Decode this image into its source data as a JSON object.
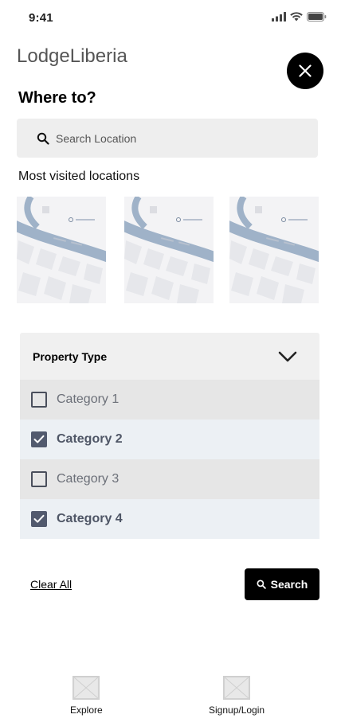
{
  "status_bar": {
    "time": "9:41",
    "icons": [
      "signal-icon",
      "wifi-icon",
      "battery-icon"
    ]
  },
  "header": {
    "app_title": "LodgeLiberia",
    "close_icon": "close-icon"
  },
  "search": {
    "heading": "Where to?",
    "placeholder": "Search Location",
    "icon": "search-icon"
  },
  "visited": {
    "heading": "Most visited locations",
    "thumbnail_count": 3
  },
  "property_type": {
    "title": "Property Type",
    "toggle_icon": "chevron-down-icon",
    "categories": [
      {
        "label": "Category 1",
        "checked": false
      },
      {
        "label": "Category 2",
        "checked": true
      },
      {
        "label": "Category 3",
        "checked": false
      },
      {
        "label": "Category 4",
        "checked": true
      }
    ]
  },
  "actions": {
    "clear_label": "Clear All",
    "search_label": "Search"
  },
  "bottom_nav": {
    "items": [
      {
        "label": "Explore"
      },
      {
        "label": "Signup/Login"
      }
    ]
  },
  "colors": {
    "primary": "#000000",
    "checked": "#525a6e",
    "row_gray": "#e6e6e6",
    "row_blue": "#ecf0f4",
    "map_road": "#9fb2c8"
  }
}
